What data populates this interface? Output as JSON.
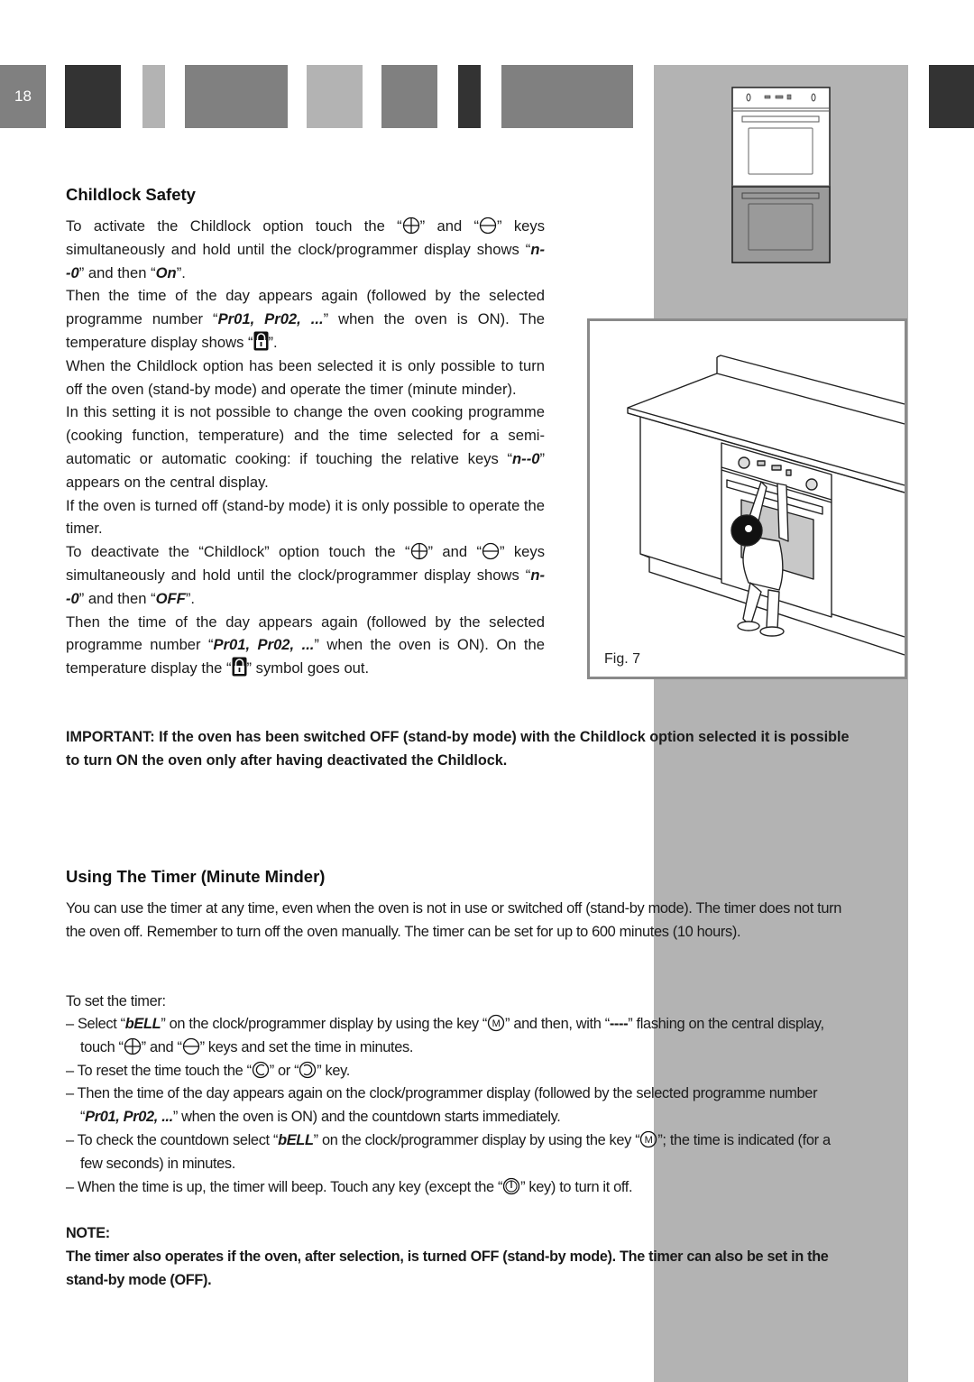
{
  "page": {
    "number": "18",
    "header_blocks": [
      {
        "color": "#333333"
      },
      {
        "color": "#b3b3b3"
      },
      {
        "color": "#808080"
      },
      {
        "color": "#b3b3b3"
      },
      {
        "color": "#808080"
      },
      {
        "color": "#333333"
      },
      {
        "color": "#808080"
      }
    ],
    "side_strip_color": "#b3b3b3"
  },
  "childlock": {
    "title": "Childlock Safety",
    "p1": {
      "a": "To activate the Childlock option touch the “",
      "b": "” and “",
      "c": "” keys simultaneously and hold until the clock/programmer display shows “",
      "code1": "n--0",
      "d": "” and then “",
      "code2": "On",
      "e": "”."
    },
    "p2": {
      "a": "Then the time of the day appears again (followed by the selected programme number “",
      "code": "Pr01, Pr02, ...",
      "b": "” when the oven is ON). The temperature display shows “",
      "c": "”."
    },
    "p3": "When the Childlock option has been selected it is only possible to turn off the oven (stand-by mode) and operate the timer (minute minder).",
    "p4": {
      "a": "In this setting it is not possible to change the oven cooking programme (cooking function, temperature) and the time selected for a semi-automatic or automatic cooking: if touching the relative keys “",
      "code": "n--0",
      "b": "” appears on the central display."
    },
    "p5": "If the oven is turned off (stand-by mode) it is only possible to operate the timer.",
    "p6": {
      "a": "To deactivate the “Childlock” option touch the “",
      "b": "” and “",
      "c": "” keys simultaneously and hold until the clock/programmer display shows “",
      "code1": "n--0",
      "d": "” and then “",
      "code2": "OFF",
      "e": "”."
    },
    "p7": {
      "a": "Then the time of the day appears again (followed by the selected programme number “",
      "code": "Pr01, Pr02, ...",
      "b": "” when the oven is ON). On the temperature display the “",
      "c": "” symbol goes out."
    },
    "important": "IMPORTANT: If the oven has been switched OFF (stand-by mode) with the Childlock option selected it is possible to turn ON the oven only after having deactivated the Childlock."
  },
  "figure": {
    "caption": "Fig. 7"
  },
  "timer": {
    "title": "Using The Timer (Minute Minder)",
    "intro": "You can use the timer at any time, even when the oven is not in use or switched off (stand-by mode). The timer does not turn the oven off. Remember to turn off the oven manually. The timer can be set for up to 600 minutes (10 hours).",
    "set_label": "To set the timer:",
    "step1": {
      "a": "– Select “",
      "code": "bELL",
      "b": "” on the clock/programmer display by using the key “",
      "c": "” and then, with “",
      "code2": "----",
      "d": "” flashing on the central display, touch “",
      "e": "” and “",
      "f": "” keys and set the time in minutes."
    },
    "step2": {
      "a": "– To reset the time touch the “",
      "b": "” or “",
      "c": "” key."
    },
    "step3": {
      "a": "– Then the time of the day appears again on the clock/programmer display (followed by the selected programme number “",
      "code": "Pr01, Pr02, ...",
      "b": "” when the oven is ON) and the countdown starts immediately."
    },
    "step4": {
      "a": "– To check the countdown select “",
      "code": "bELL",
      "b": "” on the clock/programmer display by using the key “",
      "c": "”; the time is indicated (for a few seconds) in minutes."
    },
    "step5": {
      "a": "– When the time is up, the timer will beep.  Touch any key (except the “",
      "b": "” key) to turn it off."
    },
    "note_label": "NOTE:",
    "note_text": "The timer also operates if the oven, after selection, is turned OFF (stand-by mode). The timer can also be set in the stand-by mode (OFF)."
  },
  "icons": {
    "plus": "plus-key-icon",
    "minus": "minus-key-icon",
    "lock": "padlock-icon",
    "menu": "m-key-icon",
    "reset_left": "reset-left-key-icon",
    "reset_right": "reset-right-key-icon",
    "power": "power-key-icon"
  }
}
